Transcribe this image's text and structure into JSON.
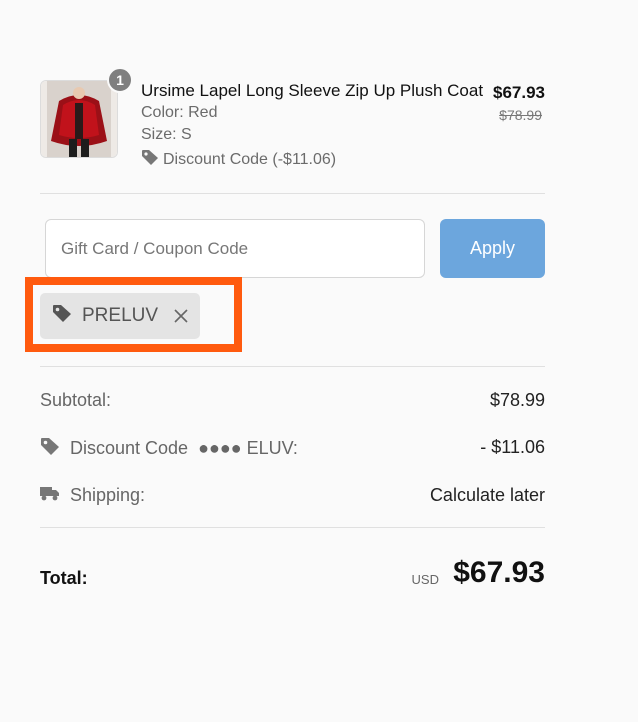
{
  "product": {
    "quantity": "1",
    "title": "Ursime Lapel Long Sleeve Zip Up Plush Coat",
    "color": "Color: Red",
    "size": "Size: S",
    "discount": "Discount Code (-$11.06)",
    "price": "$67.93",
    "original_price": "$78.99",
    "image_icon": "red-plush-coat-photo"
  },
  "coupon": {
    "placeholder": "Gift Card / Coupon Code",
    "apply_label": "Apply",
    "applied_code": "PRELUV"
  },
  "summary": {
    "subtotal_label": "Subtotal:",
    "subtotal_value": "$78.99",
    "discount_label": "Discount Code",
    "discount_code_masked": "●●●● ELUV:",
    "discount_value": "- $11.06",
    "shipping_label": "Shipping:",
    "shipping_value": "Calculate later",
    "total_label": "Total:",
    "currency": "USD",
    "total_value": "$67.93"
  },
  "colors": {
    "apply_button": "#6ca6dd",
    "highlight_border": "#ff5a0e",
    "chip_bg": "#e4e4e4"
  }
}
